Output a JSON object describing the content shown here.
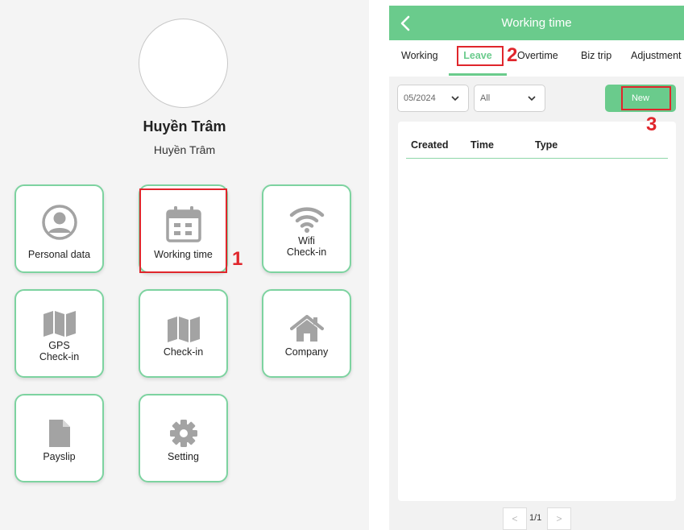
{
  "profile": {
    "name": "Huyền Trâm",
    "subtitle": "Huyền Trâm"
  },
  "menu": [
    {
      "label": "Personal data",
      "icon": "person-circle-icon"
    },
    {
      "label": "Working time",
      "icon": "calendar-icon"
    },
    {
      "label": "Wifi\nCheck-in",
      "icon": "wifi-icon"
    },
    {
      "label": "GPS\nCheck-in",
      "icon": "map-icon"
    },
    {
      "label": "Check-in",
      "icon": "map-icon"
    },
    {
      "label": "Company",
      "icon": "home-icon"
    },
    {
      "label": "Payslip",
      "icon": "document-icon"
    },
    {
      "label": "Setting",
      "icon": "gear-icon"
    }
  ],
  "annotations": [
    "1",
    "2",
    "3"
  ],
  "app": {
    "header_title": "Working time",
    "tabs": [
      "Working",
      "Leave",
      "Overtime",
      "Biz trip",
      "Adjustment"
    ],
    "active_tab": "Leave",
    "filters": {
      "month": "05/2024",
      "type": "All"
    },
    "new_button": "New",
    "table_headers": [
      "Created",
      "Time",
      "Type"
    ],
    "rows": [],
    "pagination": {
      "prev": "<",
      "text": "1/1",
      "next": ">"
    }
  },
  "colors": {
    "accent": "#6acb8c",
    "tile_border": "#7dd3a0",
    "annotation": "#e0262c",
    "icon_gray": "#a3a3a3"
  }
}
